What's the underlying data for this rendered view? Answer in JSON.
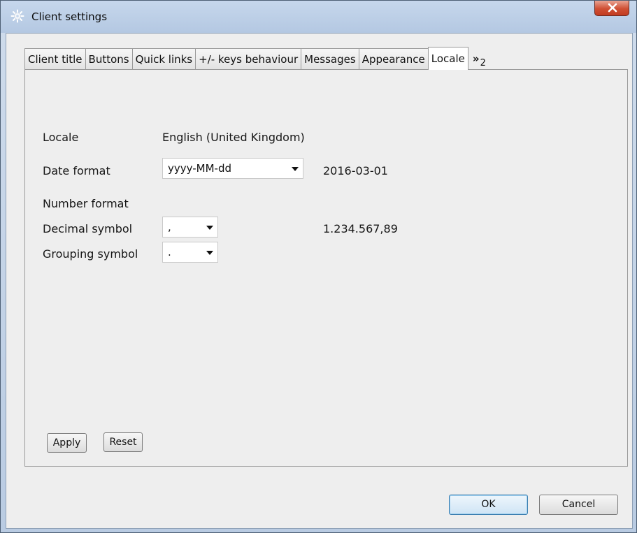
{
  "window": {
    "title": "Client settings",
    "icons": {
      "app": "gear-icon",
      "close": "close-icon"
    },
    "colors": {
      "close_button": "#c9442a",
      "title_bar": "#bfd1e8",
      "dialog_bg": "#eeeeee",
      "default_button_border": "#3c7fb1"
    }
  },
  "tabs": [
    {
      "label": "Client title",
      "active": false
    },
    {
      "label": "Buttons",
      "active": false
    },
    {
      "label": "Quick links",
      "active": false
    },
    {
      "label": "+/- keys behaviour",
      "active": false
    },
    {
      "label": "Messages",
      "active": false
    },
    {
      "label": "Appearance",
      "active": false
    },
    {
      "label": "Locale",
      "active": true
    }
  ],
  "tabs_overflow": {
    "glyph": "»",
    "count": "2"
  },
  "locale_panel": {
    "locale_label": "Locale",
    "locale_value": "English (United Kingdom)",
    "date_format_label": "Date format",
    "date_format_value": "yyyy-MM-dd",
    "date_preview": "2016-03-01",
    "number_format_label": "Number format",
    "decimal_symbol_label": "Decimal symbol",
    "decimal_symbol_value": ",",
    "number_preview": "1.234.567,89",
    "grouping_symbol_label": "Grouping symbol",
    "grouping_symbol_value": ".",
    "apply_label": "Apply",
    "reset_label": "Reset"
  },
  "footer": {
    "ok_label": "OK",
    "cancel_label": "Cancel"
  }
}
